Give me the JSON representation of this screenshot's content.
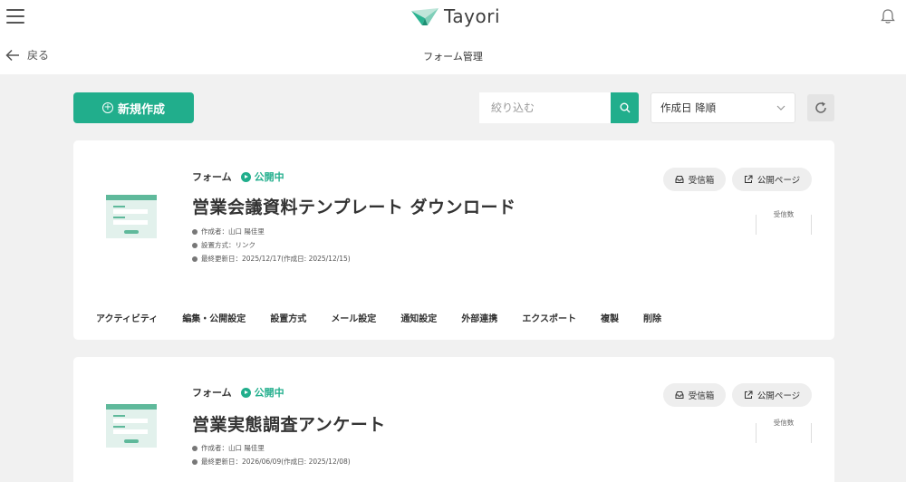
{
  "header": {
    "logo_text": "Tayori",
    "back_label": "戻る",
    "page_title": "フォーム管理"
  },
  "toolbar": {
    "new_label": "新規作成",
    "search_placeholder": "絞り込む",
    "sort_value": "作成日 降順"
  },
  "colors": {
    "accent": "#21ae8c",
    "background": "#f1f1f1"
  },
  "forms": [
    {
      "type": "フォーム",
      "status": "公開中",
      "title": "営業会議資料テンプレート ダウンロード",
      "meta": [
        "作成者：山口 陽佳里",
        "設置方式：リンク",
        "最終更新日：2025/12/17(作成日: 2025/12/15)"
      ],
      "inbox_label": "受信箱",
      "public_label": "公開ページ",
      "count_label": "受信数",
      "actions": [
        "アクティビティ",
        "編集・公開設定",
        "設置方式",
        "メール設定",
        "通知設定",
        "外部連携",
        "エクスポート",
        "複製",
        "削除"
      ]
    },
    {
      "type": "フォーム",
      "status": "公開中",
      "title": "営業実態調査アンケート",
      "meta": [
        "作成者：山口 陽佳里",
        "最終更新日：2026/06/09(作成日: 2025/12/08)"
      ],
      "inbox_label": "受信箱",
      "public_label": "公開ページ",
      "count_label": "受信数"
    }
  ]
}
